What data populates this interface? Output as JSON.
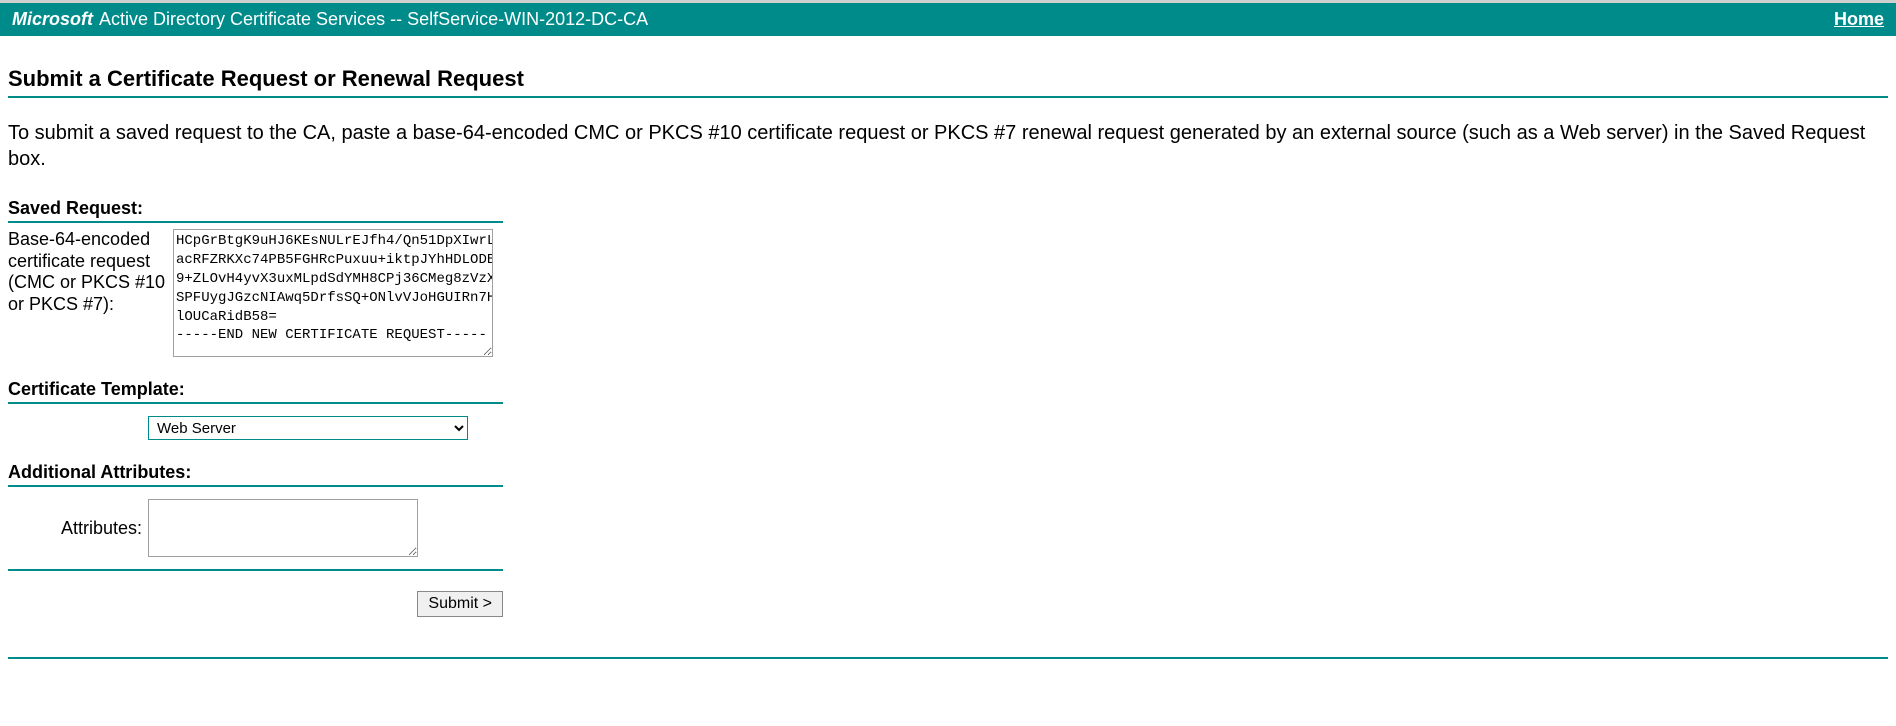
{
  "header": {
    "brand": "Microsoft",
    "title": " Active Directory Certificate Services  --  SelfService-WIN-2012-DC-CA",
    "home": "Home"
  },
  "page": {
    "title": "Submit a Certificate Request or Renewal Request",
    "description": "To submit a saved request to the CA, paste a base-64-encoded CMC or PKCS #10 certificate request or PKCS #7 renewal request generated by an external source (such as a Web server) in the Saved Request box."
  },
  "saved_request": {
    "section_label": "Saved Request:",
    "field_label": "Base-64-encoded certificate request (CMC or PKCS #10 or PKCS #7):",
    "value": "HCpGrBtgK9uHJ6KEsNULrEJfh4/Qn51DpXIwrLFC\nacRFZRKXc74PB5FGHRcPuxuu+iktpJYhHDLODBxe\n9+ZLOvH4yvX3uxMLpdSdYMH8CPj36CMeg8zVzXBu\nSPFUygJGzcNIAwq5DrfsSQ+ONlvVJoHGUIRn7HHk\nlOUCaRidB58=\n-----END NEW CERTIFICATE REQUEST-----"
  },
  "certificate_template": {
    "section_label": "Certificate Template:",
    "selected": "Web Server"
  },
  "additional_attributes": {
    "section_label": "Additional Attributes:",
    "field_label": "Attributes:",
    "value": ""
  },
  "submit": {
    "label": "Submit >"
  }
}
